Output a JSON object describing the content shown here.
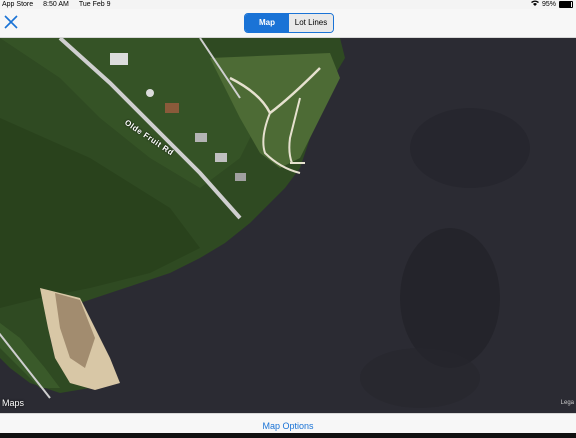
{
  "status_bar": {
    "app_back": "App Store",
    "time": "8:50 AM",
    "date": "Tue Feb 9",
    "battery_text": "95%",
    "battery_level": 0.95,
    "icons": [
      "wifi-icon",
      "battery-icon"
    ]
  },
  "header": {
    "close_icon": "close-icon",
    "tabs": [
      {
        "label": "Map",
        "selected": true
      },
      {
        "label": "Lot Lines",
        "selected": false
      }
    ]
  },
  "map": {
    "road_label": "Olde Fruit Rd",
    "attribution": "Maps",
    "legal": "Lega"
  },
  "bottom": {
    "map_options": "Map Options"
  },
  "colors": {
    "accent": "#1a73d6",
    "water": "#2b2b33",
    "forest": "#2f4a22"
  }
}
